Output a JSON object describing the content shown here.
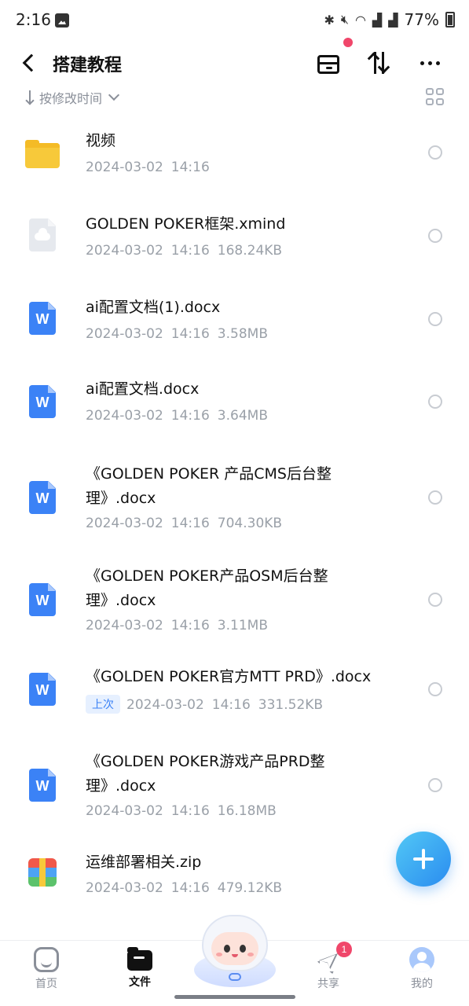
{
  "status_bar": {
    "time": "2:16",
    "battery": "77%",
    "icons": [
      "bluetooth-icon",
      "mute-icon",
      "wifi-icon",
      "signal-icon",
      "signal-icon",
      "battery-icon"
    ]
  },
  "header": {
    "title": "搭建教程"
  },
  "sort": {
    "label": "按修改时间"
  },
  "files": [
    {
      "name": "视频",
      "date": "2024-03-02",
      "time": "14:16",
      "size": "",
      "type": "folder"
    },
    {
      "name": "GOLDEN POKER框架.xmind",
      "date": "2024-03-02",
      "time": "14:16",
      "size": "168.24KB",
      "type": "cloud"
    },
    {
      "name": "ai配置文档(1).docx",
      "date": "2024-03-02",
      "time": "14:16",
      "size": "3.58MB",
      "type": "doc"
    },
    {
      "name": "ai配置文档.docx",
      "date": "2024-03-02",
      "time": "14:16",
      "size": "3.64MB",
      "type": "doc"
    },
    {
      "name": "《GOLDEN POKER 产品CMS后台整理》.docx",
      "line1": "《GOLDEN POKER 产品CMS后台整",
      "line2": "理》.docx",
      "date": "2024-03-02",
      "time": "14:16",
      "size": "704.30KB",
      "type": "doc"
    },
    {
      "name": "《GOLDEN POKER产品OSM后台整理》.docx",
      "line1": "《GOLDEN POKER产品OSM后台整",
      "line2": "理》.docx",
      "date": "2024-03-02",
      "time": "14:16",
      "size": "3.11MB",
      "type": "doc"
    },
    {
      "name": "《GOLDEN POKER官方MTT PRD》.docx",
      "tag": "上次",
      "date": "2024-03-02",
      "time": "14:16",
      "size": "331.52KB",
      "type": "doc"
    },
    {
      "name": "《GOLDEN POKER游戏产品PRD整理》.docx",
      "line1": "《GOLDEN POKER游戏产品PRD整",
      "line2": "理》.docx",
      "date": "2024-03-02",
      "time": "14:16",
      "size": "16.18MB",
      "type": "doc"
    },
    {
      "name": "运维部署相关.zip",
      "date": "2024-03-02",
      "time": "14:16",
      "size": "479.12KB",
      "type": "zip"
    }
  ],
  "bottom_nav": {
    "items": [
      {
        "label": "首页",
        "icon": "home-icon",
        "active": false
      },
      {
        "label": "文件",
        "icon": "folder-icon",
        "active": true
      },
      {
        "label": "共享",
        "icon": "share-icon",
        "active": false,
        "badge": "1"
      },
      {
        "label": "我的",
        "icon": "profile-icon",
        "active": false
      }
    ]
  },
  "colors": {
    "accent": "#3b82f6",
    "badge": "#f0466a",
    "folder": "#f7c93a",
    "meta_text": "#9aa0a8"
  }
}
